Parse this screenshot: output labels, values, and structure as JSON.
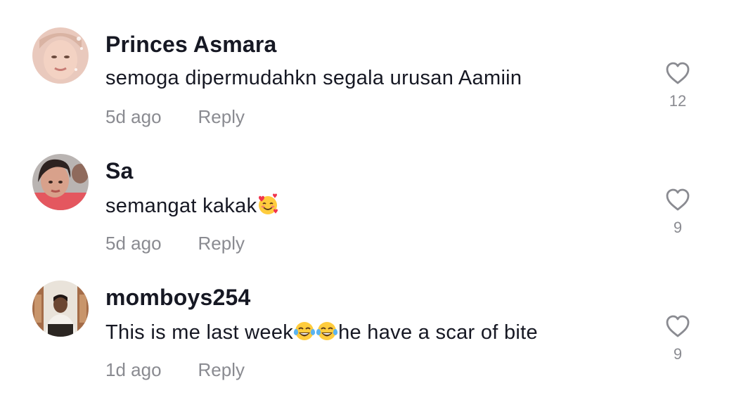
{
  "comments": [
    {
      "username": "Princes Asmara",
      "text": "semoga dipermudahkn segala urusan Aamiin",
      "time": "5d ago",
      "reply_label": "Reply",
      "likes": "12"
    },
    {
      "username": "Sa",
      "text": "semangat kakak",
      "emoji_after": "smiling-face-with-hearts",
      "time": "5d ago",
      "reply_label": "Reply",
      "likes": "9"
    },
    {
      "username": "momboys254",
      "text_before": "This is me last week",
      "emoji_mid": [
        "face-with-tears-of-joy",
        "face-with-tears-of-joy"
      ],
      "text_after": "he have a scar of bite",
      "time": "1d ago",
      "reply_label": "Reply",
      "likes": "9"
    }
  ],
  "colors": {
    "primary_text": "#161823",
    "secondary_text": "#8a8b91",
    "background": "#ffffff"
  },
  "icons": {
    "like": "heart-outline-icon"
  }
}
